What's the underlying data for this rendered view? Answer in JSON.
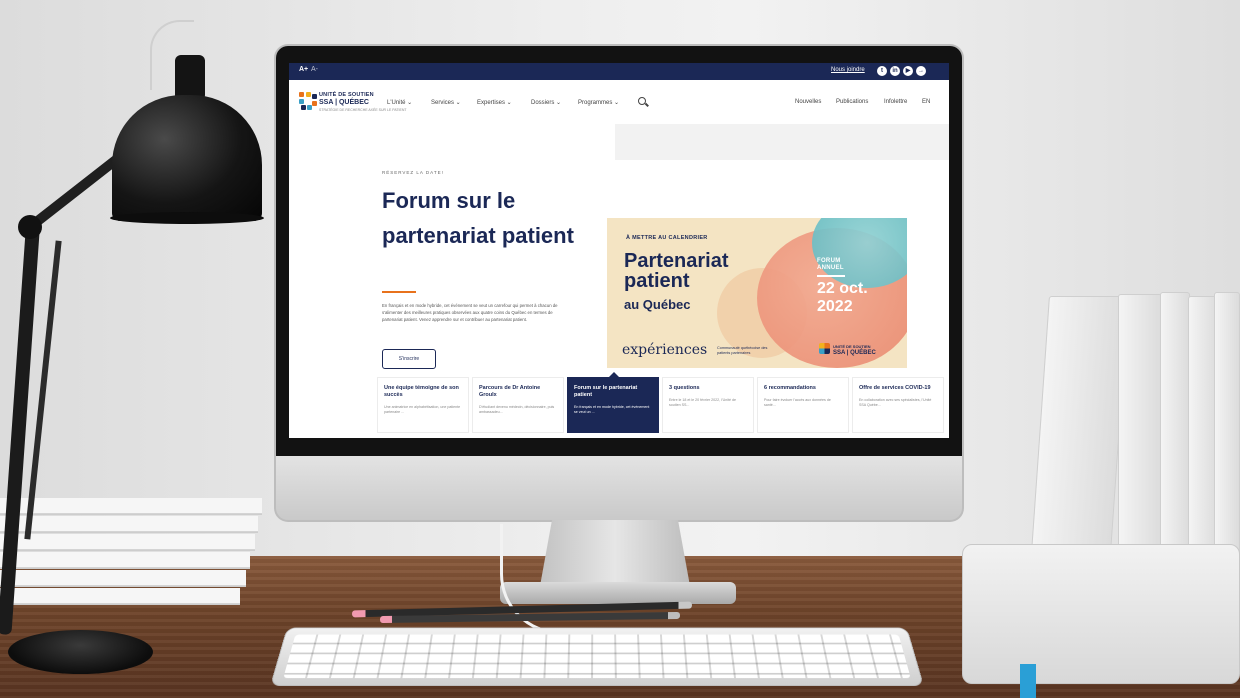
{
  "topbar": {
    "font_larger": "A+",
    "font_smaller": "A-",
    "contact_link": "Nous joindre",
    "social_icons": [
      "twitter-icon",
      "linkedin-icon",
      "youtube-icon",
      "login-icon"
    ]
  },
  "brand": {
    "line1": "UNITÉ DE SOUTIEN",
    "line2": "SSA | QUÉBEC",
    "tagline": "STRATÉGIE DE RECHERCHE AXÉE SUR LE PATIENT"
  },
  "nav": {
    "main": [
      "L'Unité ⌄",
      "Services ⌄",
      "Expertises ⌄",
      "Dossiers ⌄",
      "Programmes ⌄"
    ],
    "secondary": [
      "Nouvelles",
      "Publications",
      "Infolettre",
      "EN"
    ]
  },
  "hero": {
    "kicker": "RÉSERVEZ LA DATE!",
    "title": "Forum sur le partenariat patient",
    "description": "En français et en mode hybride, cet événement se veut un carrefour qui permet à chacun de s'alimenter des meilleures pratiques observées aux quatre coins du Québec en termes de partenariat patient. Venez apprendre sur et contribuer au partenariat patient.",
    "button": "S'inscrire"
  },
  "banner": {
    "kicker": "À METTRE AU CALENDRIER",
    "title_line1": "Partenariat",
    "title_line2": "patient",
    "subtitle": "au Québec",
    "forum_line1": "FORUM",
    "forum_line2": "ANNUEL",
    "date_line1": "22 oct.",
    "date_line2": "2022",
    "experiences": "expériences",
    "experiences_note": "Communauté québécoise des patients partenaires",
    "logo_line1": "UNITÉ DE SOUTIEN",
    "logo_line2": "SSA | QUÉBEC"
  },
  "cards": [
    {
      "title": "Une équipe témoigne de son succès",
      "desc": "Une animatrice en alphabétisation, une patiente partenaire ..."
    },
    {
      "title": "Parcours de Dr Antoine Groulx",
      "desc": "D'étudiant devenu médecin, décisionnaire, puis ambassadeu..."
    },
    {
      "title": "Forum sur le partenariat patient",
      "desc": "En français et en mode hybride, cet événement se veut un ..."
    },
    {
      "title": "3 questions",
      "desc": "Entre le 18 et le 20 février 2022, l'Unité de soutien SS..."
    },
    {
      "title": "6 recommandations",
      "desc": "Pour faire évoluer l'accès aux données de santé..."
    },
    {
      "title": "Offre de services COVID-19",
      "desc": "En collaboration avec ses spécialistes, l'Unité SSA Québe..."
    }
  ],
  "colors": {
    "navy": "#1b2856",
    "orange": "#e8721c",
    "banner_bg": "#f4e4c3"
  }
}
